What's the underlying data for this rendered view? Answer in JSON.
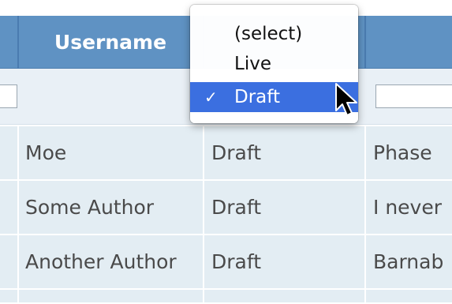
{
  "table": {
    "headers": [
      "Username",
      "",
      ""
    ],
    "rows": [
      {
        "username": "Moe",
        "status": "Draft",
        "message": "Phase"
      },
      {
        "username": "Some Author",
        "status": "Draft",
        "message": "I never"
      },
      {
        "username": "Another Author",
        "status": "Draft",
        "message": "Barnab"
      }
    ]
  },
  "dropdown": {
    "options": [
      "(select)",
      "Live",
      "Draft"
    ],
    "selected_index": 2,
    "check_mark": "✓"
  },
  "colors": {
    "header_bg": "#5f92c3",
    "row_bg": "#e3edf3",
    "selection": "#3b6fe0"
  }
}
